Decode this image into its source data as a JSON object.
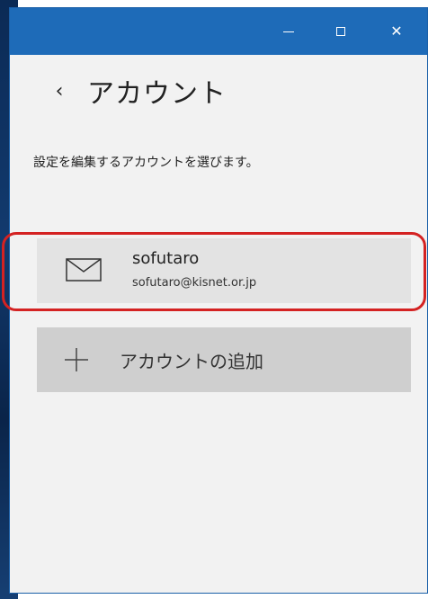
{
  "window": {
    "controls": {
      "minimize_icon": "minimize-icon",
      "maximize_icon": "maximize-icon",
      "close_icon": "close-icon",
      "close_glyph": "✕"
    },
    "accent_color": "#1e6bb8"
  },
  "header": {
    "back_glyph": "‹",
    "title": "アカウント"
  },
  "main": {
    "instruction": "設定を編集するアカウントを選びます。",
    "accounts": [
      {
        "name": "sofutaro",
        "email": "sofutaro@kisnet.or.jp",
        "icon": "mail-icon"
      }
    ],
    "add_account_label": "アカウントの追加",
    "add_account_icon": "plus-icon",
    "highlight_color": "#d42222"
  }
}
